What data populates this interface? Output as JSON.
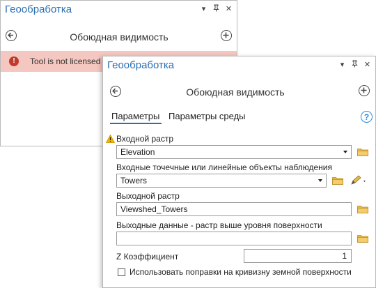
{
  "back_pane": {
    "title": "Геообработка",
    "tool_title": "Обоюдная видимость",
    "license_message": "Tool is not licensed"
  },
  "front_pane": {
    "title": "Геообработка",
    "tool_title": "Обоюдная видимость",
    "tabs": [
      {
        "label": "Параметры",
        "active": true
      },
      {
        "label": "Параметры среды",
        "active": false
      }
    ],
    "help_glyph": "?",
    "params": {
      "input_raster_label": "Входной растр",
      "input_raster_value": "Elevation",
      "observer_label": "Входные точечные или линейные объекты наблюдения",
      "observer_value": "Towers",
      "output_raster_label": "Выходной растр",
      "output_raster_value": "Viewshed_Towers",
      "output_agl_label": "Выходные данные - растр выше уровня поверхности",
      "output_agl_value": "",
      "z_factor_label": "Z Коэффициент",
      "z_factor_value": "1",
      "curvature_label": "Использовать поправки на кривизну земной поверхности",
      "curvature_checked": false
    }
  },
  "colors": {
    "title_blue": "#2a6fb3",
    "license_bg": "#f4c7c0",
    "error_red": "#c0392b",
    "folder_yellow": "#e8b84a",
    "warning_yellow": "#f2b500"
  },
  "icons": [
    "back-arrow-icon",
    "add-icon",
    "error-icon",
    "help-icon",
    "folder-icon",
    "warning-icon",
    "pencil-icon",
    "dropdown-arrow-icon"
  ]
}
